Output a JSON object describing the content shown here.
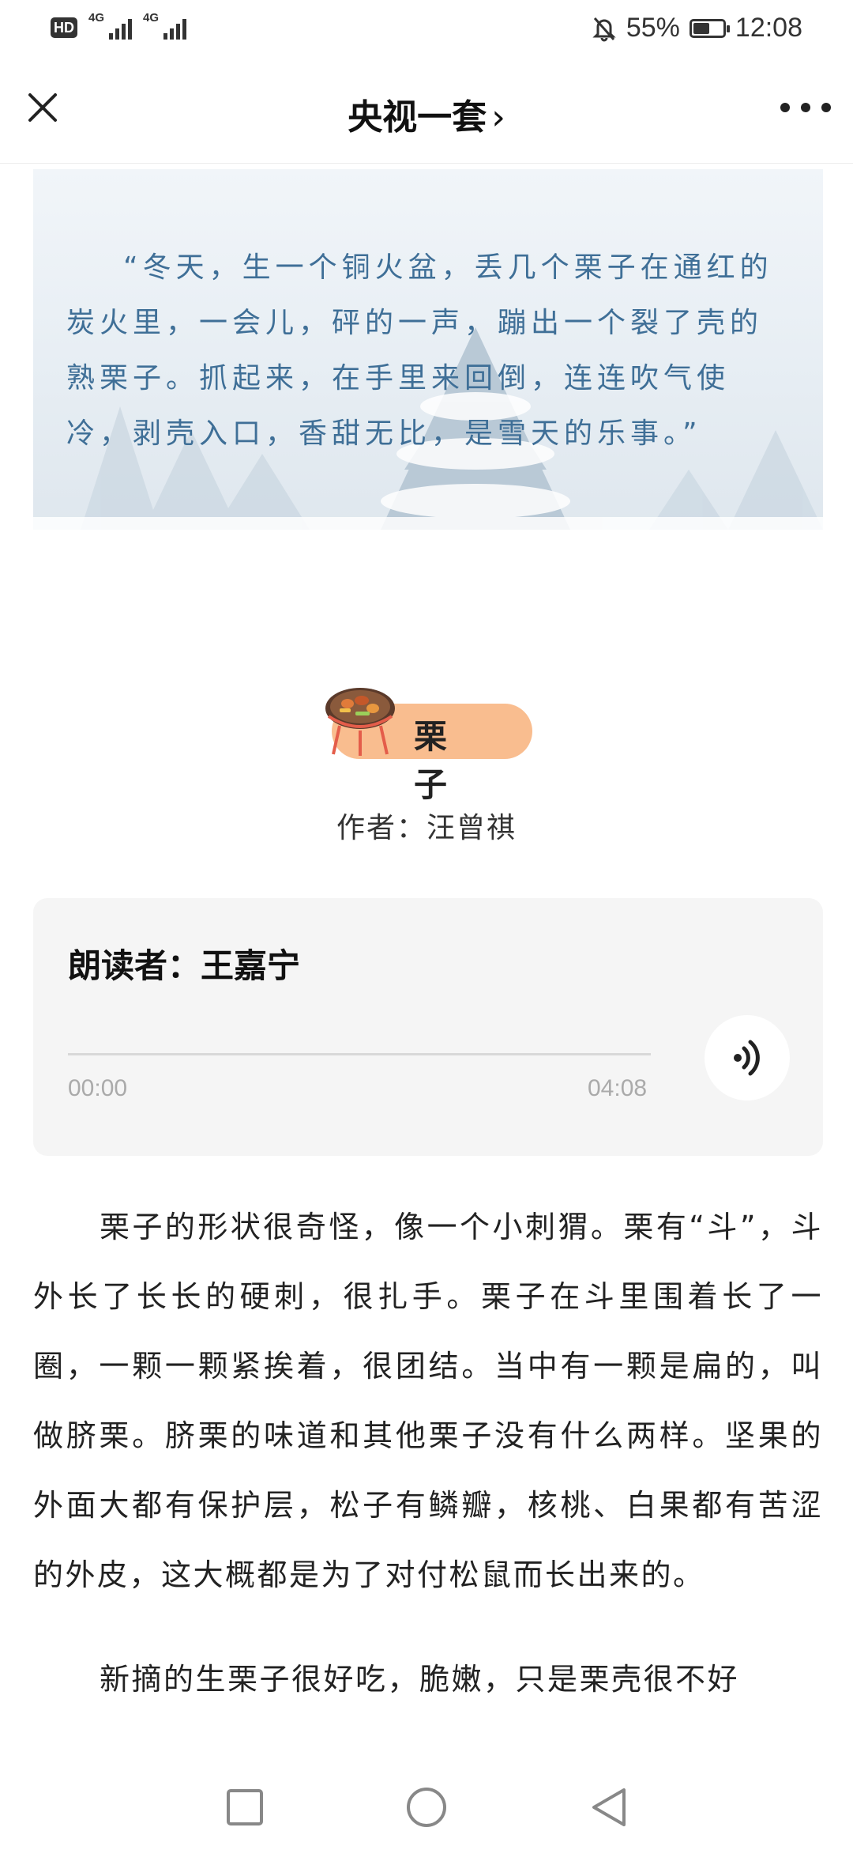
{
  "status_bar": {
    "hd_label": "HD",
    "signal1_label": "4G",
    "signal2_label": "4G",
    "battery_percent": "55%",
    "battery_level": 0.55,
    "time": "12:08",
    "icons": [
      "hd-icon",
      "signal-icon",
      "mute-bell-icon",
      "battery-icon"
    ]
  },
  "nav": {
    "title": "央视一套",
    "title_chevron": "›",
    "icons": [
      "close-icon",
      "more-icon"
    ]
  },
  "quote": {
    "text": "“冬天，生一个铜火盆，丢几个栗子在通红的炭火里，一会儿，砰的一声，蹦出一个裂了壳的熟栗子。抓起来，在手里来回倒，连连吹气使冷，剥壳入口，香甜无比，是雪天的乐事。”"
  },
  "article_header": {
    "title": "栗 子",
    "author": "作者：汪曾祺",
    "icon": "grill-icon"
  },
  "audio": {
    "reader": "朗读者：王嘉宁",
    "current_time": "00:00",
    "total_time": "04:08",
    "progress": 0,
    "icon": "audio-wave-icon"
  },
  "article": {
    "paragraphs": [
      "栗子的形状很奇怪，像一个小刺猬。栗有“斗”，斗外长了长长的硬刺，很扎手。栗子在斗里围着长了一圈，一颗一颗紧挨着，很团结。当中有一颗是扁的，叫做脐栗。脐栗的味道和其他栗子没有什么两样。坚果的外面大都有保护层，松子有鳞瓣，核桃、白果都有苦涩的外皮，这大概都是为了对付松鼠而长出来的。",
      "新摘的生栗子很好吃，脆嫩，只是栗壳很不好"
    ]
  },
  "bottom_nav": {
    "icons": [
      "recents-square-icon",
      "home-circle-icon",
      "back-triangle-icon"
    ]
  }
}
